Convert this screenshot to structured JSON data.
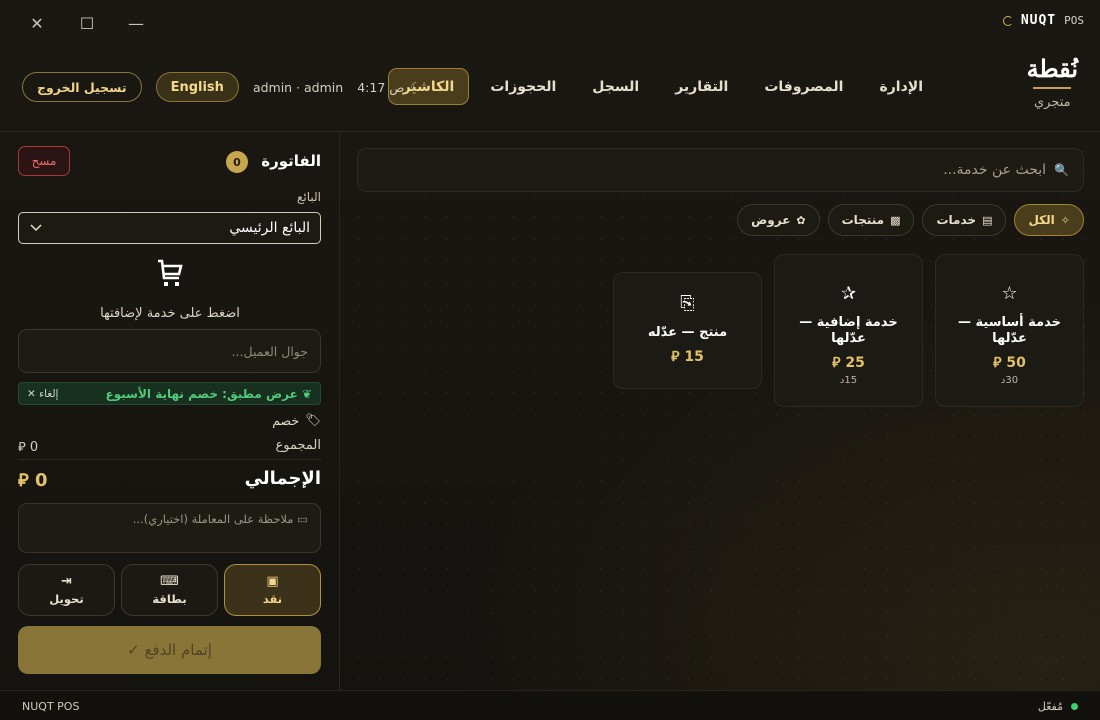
{
  "titlebar": {
    "brand_name": "NUQT",
    "brand_suffix": "POS",
    "close_glyph": "✕",
    "maximize_glyph": "☐",
    "minimize_glyph": "—"
  },
  "header": {
    "logo_name": "نُقطة",
    "logo_sub": "متجري",
    "nav": [
      "الكاشير",
      "الحجوزات",
      "السجل",
      "التقارير",
      "المصروفات",
      "الإدارة"
    ],
    "active_nav": "الكاشير",
    "time": "4:17 ص",
    "user": "admin · admin",
    "lang_button": "English",
    "logout_button": "تسجيل الخروج"
  },
  "invoice": {
    "title": "الفاتورة",
    "count": "0",
    "clear_button": "مسح",
    "seller_label": "البائع",
    "seller_value": "البائع الرئيسي",
    "empty_hint": "اضغط على خدمة لإضافتها",
    "phone_placeholder": "جوال العميل...",
    "promo_text": "عرض مطبق: خصم نهاية الأسبوع",
    "promo_cancel": "✕ إلغاء",
    "discount_label": "خصم",
    "subtotal_label": "المجموع",
    "subtotal_value": "0",
    "total_label": "الإجمالي",
    "total_value": "0",
    "currency": "⃁",
    "note_placeholder": "ملاحظة على المعاملة (اختياري)...",
    "payment_methods": [
      {
        "label": "نقد",
        "icon": "cash-icon",
        "glyph": "💵",
        "active": true
      },
      {
        "label": "بطاقة",
        "icon": "card-icon",
        "glyph": "⌨",
        "active": false
      },
      {
        "label": "تحويل",
        "icon": "transfer-icon",
        "glyph": "➜",
        "active": false
      }
    ],
    "complete_button": "إتمام الدفع ✓"
  },
  "catalog": {
    "search_placeholder": "ابحث عن خدمة...",
    "filters": [
      {
        "label": "الكل",
        "icon": "sparkle-icon",
        "glyph": "✨",
        "active": true
      },
      {
        "label": "خدمات",
        "icon": "list-icon",
        "glyph": "▤",
        "active": false
      },
      {
        "label": "منتجات",
        "icon": "box-icon",
        "glyph": "▩",
        "active": false
      },
      {
        "label": "عروض",
        "icon": "gift-icon",
        "glyph": "✿",
        "active": false
      }
    ],
    "cards": [
      {
        "icon": "star-icon",
        "glyph": "★",
        "name": "خدمة أساسية — عدّلها",
        "price": "50",
        "sub": "30د"
      },
      {
        "icon": "stars-icon",
        "glyph": "✨",
        "name": "خدمة إضافية — عدّلها",
        "price": "25",
        "sub": "15د"
      },
      {
        "icon": "gift-box-icon",
        "glyph": "🎁",
        "name": "منتج — عدّله",
        "price": "15",
        "sub": ""
      }
    ]
  },
  "statusbar": {
    "app_name": "NUQT POS",
    "status_text": "مُفعّل",
    "status_color": "#3fcf72"
  },
  "colors": {
    "accent": "#c8a64f",
    "background": "#15130f",
    "danger": "#ef6b6b",
    "success": "#52c97b"
  }
}
